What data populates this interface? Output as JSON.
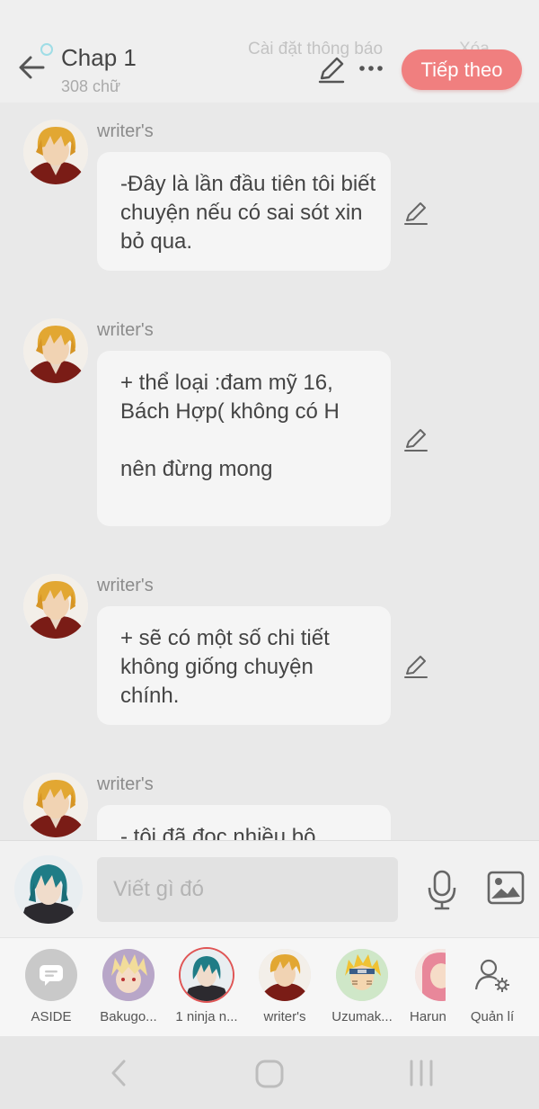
{
  "header": {
    "title": "Chap 1",
    "subtitle": "308 chữ",
    "notification_settings": "Cài đặt thông báo",
    "delete_label": "Xóa",
    "next_label": "Tiếp theo"
  },
  "messages": [
    {
      "author": "writer's",
      "text": "-Đây là lần đầu tiên tôi biết chuyện nếu có sai sót xin bỏ qua."
    },
    {
      "author": "writer's",
      "text": "+ thể loại :đam mỹ 16, Bách Hợp( không có H\n\n nên đừng mong"
    },
    {
      "author": "writer's",
      "text": "+ sẽ có một số chi tiết không giống chuyện chính."
    },
    {
      "author": "writer's",
      "text": "- tôi đã đọc nhiều bộ"
    }
  ],
  "composer": {
    "placeholder": "Viết gì đó"
  },
  "characters": [
    {
      "name": "ASIDE"
    },
    {
      "name": "Bakugo..."
    },
    {
      "name": "1 ninja n..."
    },
    {
      "name": "writer's"
    },
    {
      "name": "Uzumak..."
    },
    {
      "name": "Harun"
    },
    {
      "name": "Quản lí"
    }
  ],
  "colors": {
    "accent": "#f07f7f",
    "background": "#e9e9e9",
    "bubble": "#f5f5f5"
  },
  "icons": {
    "back": "arrow-left-icon",
    "edit": "pencil-icon",
    "more": "more-dots-icon",
    "mic": "microphone-icon",
    "image": "image-icon",
    "aside": "chat-bubble-icon",
    "manage": "user-settings-icon"
  }
}
